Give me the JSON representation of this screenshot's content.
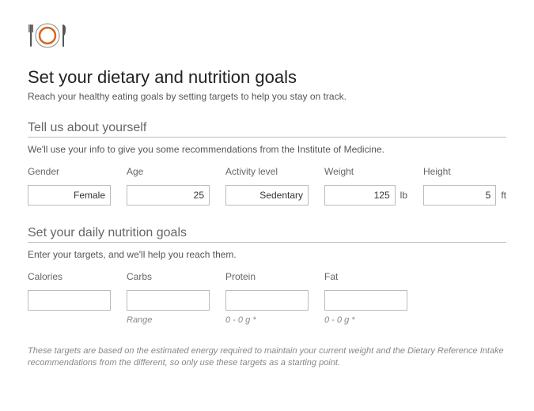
{
  "title": "Set your dietary and nutrition goals",
  "subtitle": "Reach your healthy eating goals by setting targets to help you stay on track.",
  "section1": {
    "heading": "Tell us about yourself",
    "desc": "We'll use your info to give you some recommendations from the Institute of Medicine.",
    "fields": {
      "gender": {
        "label": "Gender",
        "value": "Female"
      },
      "age": {
        "label": "Age",
        "value": "25"
      },
      "activity": {
        "label": "Activity level",
        "value": "Sedentary"
      },
      "weight": {
        "label": "Weight",
        "value": "125",
        "unit": "lb"
      },
      "height": {
        "label": "Height",
        "value": "5",
        "unit": "ft"
      }
    }
  },
  "section2": {
    "heading": "Set your daily nutrition goals",
    "desc": "Enter your targets, and we'll help you reach them.",
    "fields": {
      "calories": {
        "label": "Calories",
        "value": "",
        "hint": ""
      },
      "carbs": {
        "label": "Carbs",
        "value": "",
        "hint": "Range"
      },
      "protein": {
        "label": "Protein",
        "value": "",
        "hint": "0 - 0 g *"
      },
      "fat": {
        "label": "Fat",
        "value": "",
        "hint": "0 - 0 g *"
      }
    }
  },
  "footnote": "These targets are based on the estimated energy required to maintain your current weight and the Dietary Reference Intake recommendations from the different, so only use these targets as a starting point."
}
